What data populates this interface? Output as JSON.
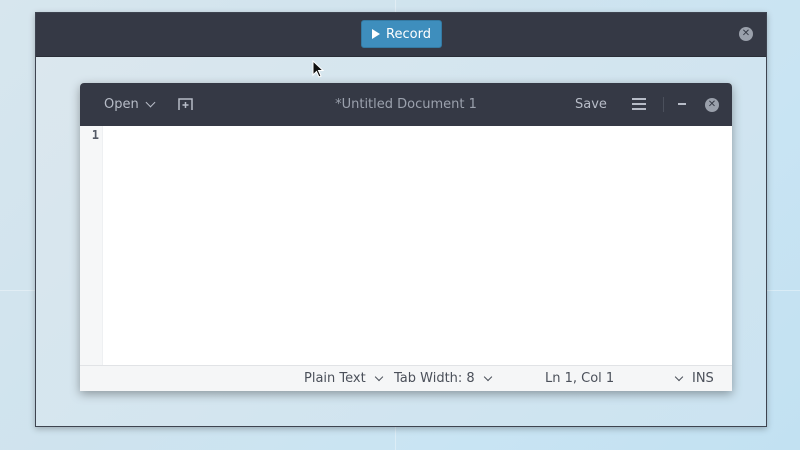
{
  "recorder": {
    "record_label": "Record"
  },
  "editor": {
    "open_label": "Open",
    "title": "*Untitled Document 1",
    "save_label": "Save",
    "line_numbers": [
      "1"
    ]
  },
  "status_bar": {
    "language": "Plain Text",
    "tab_width": "Tab Width: 8",
    "position": "Ln 1, Col 1",
    "mode": "INS"
  },
  "icons": {
    "play": "play-icon",
    "close": "close-icon",
    "new_tab": "new-tab-icon",
    "menu": "hamburger-menu-icon",
    "minimize": "minimize-icon",
    "chevron": "chevron-down-icon",
    "pointer": "mouse-pointer-icon"
  },
  "colors": {
    "record_button": "#3e8ebd",
    "titlebar": "#353945",
    "desktop": "#c9e4f3"
  }
}
